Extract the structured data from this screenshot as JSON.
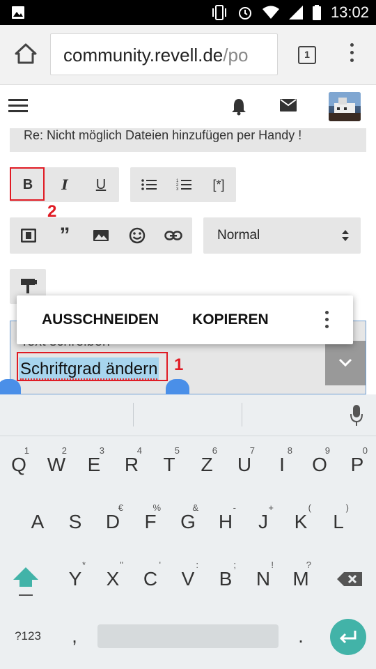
{
  "status_bar": {
    "time": "13:02"
  },
  "browser": {
    "url_host": "community.revell.de",
    "url_path": "/po",
    "tab_count": "1"
  },
  "post": {
    "subject": "Re: Nicht möglich Dateien hinzufügen per Handy !"
  },
  "toolbar": {
    "bold": "B",
    "italic": "I",
    "underline": "U",
    "code": "[*]",
    "font_size_select": "Normal"
  },
  "annotations": {
    "step1": "1",
    "step2": "2"
  },
  "context_menu": {
    "cut": "AUSSCHNEIDEN",
    "copy": "KOPIEREN"
  },
  "editor": {
    "partial_text": "Text schreiben",
    "selected_text": "Schriftgrad ändern"
  },
  "keyboard": {
    "row1": [
      {
        "key": "Q",
        "hint": "1"
      },
      {
        "key": "W",
        "hint": "2"
      },
      {
        "key": "E",
        "hint": "3"
      },
      {
        "key": "R",
        "hint": "4"
      },
      {
        "key": "T",
        "hint": "5"
      },
      {
        "key": "Z",
        "hint": "6"
      },
      {
        "key": "U",
        "hint": "7"
      },
      {
        "key": "I",
        "hint": "8"
      },
      {
        "key": "O",
        "hint": "9"
      },
      {
        "key": "P",
        "hint": "0"
      }
    ],
    "row2": [
      {
        "key": "A",
        "hint": ""
      },
      {
        "key": "S",
        "hint": ""
      },
      {
        "key": "D",
        "hint": "€"
      },
      {
        "key": "F",
        "hint": "%"
      },
      {
        "key": "G",
        "hint": "&"
      },
      {
        "key": "H",
        "hint": "-"
      },
      {
        "key": "J",
        "hint": "+"
      },
      {
        "key": "K",
        "hint": "("
      },
      {
        "key": "L",
        "hint": ")"
      }
    ],
    "row3": [
      {
        "key": "Y",
        "hint": "*"
      },
      {
        "key": "X",
        "hint": "\""
      },
      {
        "key": "C",
        "hint": "'"
      },
      {
        "key": "V",
        "hint": ":"
      },
      {
        "key": "B",
        "hint": ";"
      },
      {
        "key": "N",
        "hint": "!"
      },
      {
        "key": "M",
        "hint": "?"
      }
    ],
    "symbols": "?123",
    "comma": ",",
    "period": "."
  },
  "colors": {
    "selection": "#a7d5ee",
    "annotation_red": "#e01b24",
    "enter_key": "#42b3a8",
    "shift_key": "#42b3a8"
  }
}
